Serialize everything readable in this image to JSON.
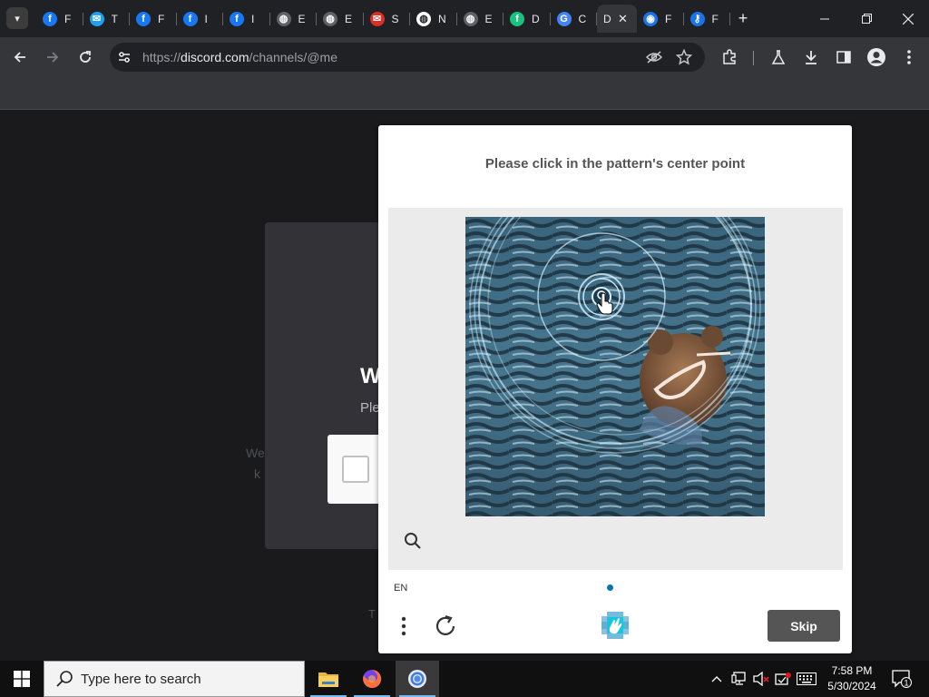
{
  "browser": {
    "tabs": [
      {
        "name": "facebook-1",
        "title": "F",
        "favicon_color": "#1877f2",
        "glyph": "f"
      },
      {
        "name": "tab-2",
        "title": "T",
        "favicon_color": "#1da1f2",
        "glyph": "✉"
      },
      {
        "name": "facebook-3",
        "title": "F",
        "favicon_color": "#1877f2",
        "glyph": "f"
      },
      {
        "name": "facebook-4",
        "title": "I",
        "favicon_color": "#1877f2",
        "glyph": "f"
      },
      {
        "name": "facebook-5",
        "title": "I",
        "favicon_color": "#1877f2",
        "glyph": "f"
      },
      {
        "name": "globe-6",
        "title": "E",
        "favicon_color": "#5f6368",
        "glyph": "◍"
      },
      {
        "name": "globe-7",
        "title": "E",
        "favicon_color": "#5f6368",
        "glyph": "◍"
      },
      {
        "name": "gmail-8",
        "title": "S",
        "favicon_color": "#d93025",
        "glyph": "✉"
      },
      {
        "name": "globe-9",
        "title": "N",
        "favicon_color": "#ffffff",
        "glyph": "◍"
      },
      {
        "name": "globe-10",
        "title": "E",
        "favicon_color": "#5f6368",
        "glyph": "◍"
      },
      {
        "name": "tab-11",
        "title": "D",
        "favicon_color": "#19c37d",
        "glyph": "f"
      },
      {
        "name": "translate-12",
        "title": "C",
        "favicon_color": "#4285f4",
        "glyph": "G"
      }
    ],
    "active_tab": {
      "title": "D",
      "close": "✕"
    },
    "tabs_after": [
      {
        "name": "tab-14",
        "title": "F",
        "favicon_color": "#1a73e8",
        "glyph": "◉"
      },
      {
        "name": "tab-15",
        "title": "F",
        "favicon_color": "#1a73e8",
        "glyph": "⚷"
      }
    ],
    "new_tab": "+",
    "url_prefix": "https://",
    "url_domain": "discord.com",
    "url_path": "/channels/@me"
  },
  "page": {
    "card_title": "W",
    "card_subtitle": "Ple",
    "bg_text_1": "We",
    "bg_text_2": "k",
    "bg_text_3": "T"
  },
  "captcha": {
    "prompt": "Please click in the pattern's center point",
    "language": "EN",
    "skip_label": "Skip",
    "accent": "#0074bf"
  },
  "taskbar": {
    "search_placeholder": "Type here to search",
    "time": "7:58 PM",
    "date": "5/30/2024",
    "notification_count": "1"
  }
}
